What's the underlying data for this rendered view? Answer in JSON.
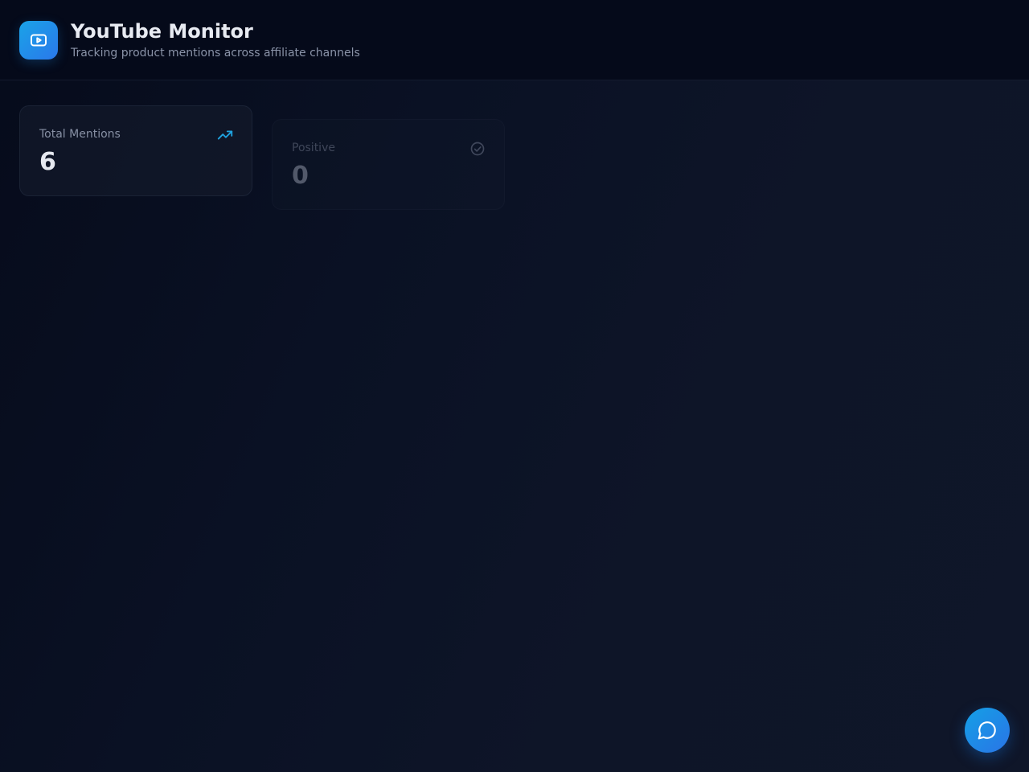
{
  "header": {
    "title": "YouTube Monitor",
    "subtitle": "Tracking product mentions across affiliate channels",
    "logo_icon": "youtube-play-icon"
  },
  "stats": [
    {
      "label": "Total Mentions",
      "value": "6",
      "icon": "trending-up-icon",
      "accent": "#1fa3e0"
    },
    {
      "label": "Positive",
      "value": "0",
      "icon": "check-circle-icon",
      "accent": "#8a93a8"
    }
  ],
  "chat_button": {
    "icon": "chat-bubble-icon"
  },
  "colors": {
    "background": "#0a1124",
    "header": "#050a1a",
    "brand_gradient_start": "#1aa3e8",
    "brand_gradient_end": "#2a78ea"
  }
}
